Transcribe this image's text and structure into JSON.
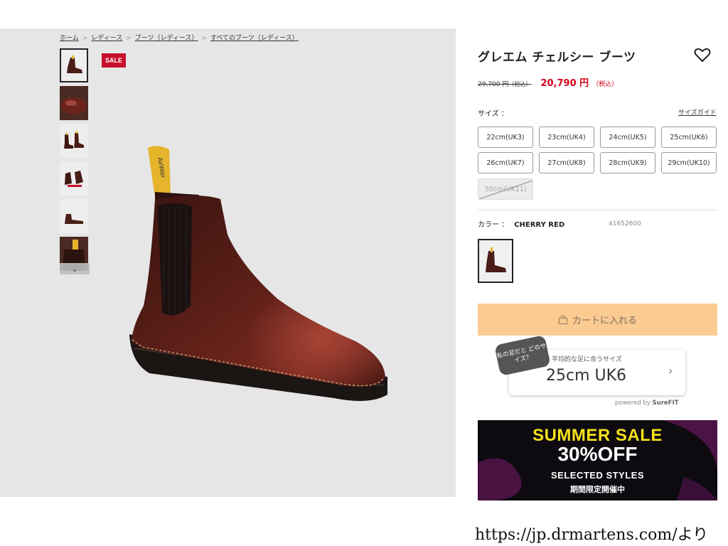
{
  "breadcrumb": [
    "ホーム",
    "レディース",
    "ブーツ（レディース）",
    "すべてのブーツ（レディース）"
  ],
  "gallery": {
    "sale_badge": "SALE",
    "thumbnail_count": 6
  },
  "product": {
    "title": "グレエム チェルシー ブーツ",
    "old_price": "29,700 円",
    "old_tax": "（税込）",
    "price": "20,790 円",
    "price_tax": "（税込）",
    "size_label": "サイズ ：",
    "size_guide": "サイズガイド",
    "sizes": [
      {
        "label": "22cm(UK3)",
        "available": true
      },
      {
        "label": "23cm(UK4)",
        "available": true
      },
      {
        "label": "24cm(UK5)",
        "available": true
      },
      {
        "label": "25cm(UK6)",
        "available": true
      },
      {
        "label": "26cm(UK7)",
        "available": true
      },
      {
        "label": "27cm(UK8)",
        "available": true
      },
      {
        "label": "28cm(UK9)",
        "available": true
      },
      {
        "label": "29cm(UK10)",
        "available": true
      },
      {
        "label": "30cm(UK11)",
        "available": false
      }
    ],
    "color_label": "カラー ：",
    "color_value": "CHERRY RED",
    "sku": "41652600",
    "cart_button": "カートに入れる"
  },
  "surefit": {
    "bubble": "私の足だと どのサイズ？",
    "subtitle": "平均的な足に合うサイズ",
    "size": "25cm UK6",
    "powered_prefix": "powered by ",
    "powered_brand": "SureFIT"
  },
  "banner": {
    "title": "SUMMER SALE",
    "off": "30%OFF",
    "subtitle": "SELECTED STYLES",
    "jp": "期間限定開催中"
  },
  "source_note": "https://jp.drmartens.com/より",
  "colors": {
    "sale_red": "#c8102e",
    "price_red": "#d0021b",
    "cart_bg": "#fbcb91",
    "banner_yellow": "#f6e11a"
  }
}
